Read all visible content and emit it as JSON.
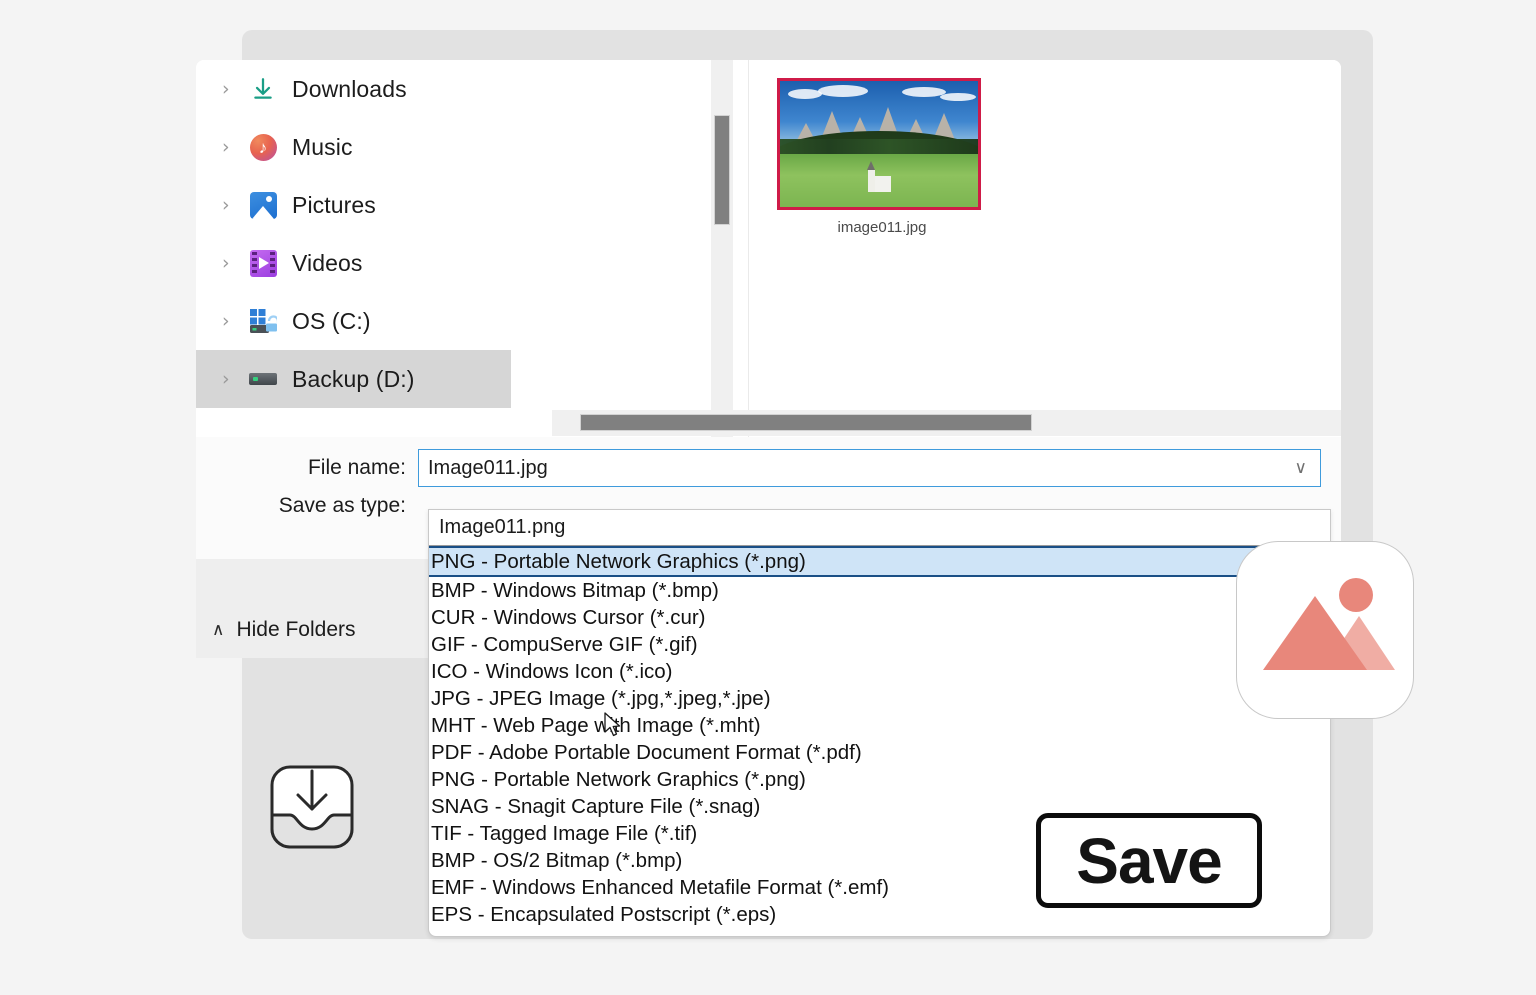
{
  "dialog": {
    "sidebar": {
      "items": [
        {
          "label": "Downloads",
          "icon": "download-arrow-icon",
          "selected": false
        },
        {
          "label": "Music",
          "icon": "music-note-icon",
          "selected": false
        },
        {
          "label": "Pictures",
          "icon": "pictures-icon",
          "selected": false
        },
        {
          "label": "Videos",
          "icon": "videos-film-icon",
          "selected": false
        },
        {
          "label": "OS (C:)",
          "icon": "windows-drive-icon",
          "selected": false
        },
        {
          "label": "Backup (D:)",
          "icon": "hard-drive-icon",
          "selected": true
        }
      ],
      "expand_chevron": "›"
    },
    "file_list": {
      "items": [
        {
          "caption": "image011.jpg",
          "selected": true
        }
      ]
    },
    "form": {
      "file_name_label": "File name:",
      "file_name_value": "Image011.jpg",
      "save_as_type_label": "Save as type:",
      "chevron_down": "∨"
    },
    "bottom": {
      "hide_folders_label": "Hide Folders",
      "hide_folders_caret": "∧"
    }
  },
  "dropdown": {
    "edit_value": "Image011.png",
    "options": [
      {
        "label": "PNG - Portable Network Graphics (*.png)",
        "selected": true
      },
      {
        "label": "BMP - Windows Bitmap (*.bmp)",
        "selected": false
      },
      {
        "label": "CUR - Windows Cursor (*.cur)",
        "selected": false
      },
      {
        "label": "GIF - CompuServe GIF (*.gif)",
        "selected": false
      },
      {
        "label": "ICO - Windows Icon (*.ico)",
        "selected": false
      },
      {
        "label": "JPG - JPEG Image (*.jpg,*.jpeg,*.jpe)",
        "selected": false
      },
      {
        "label": "MHT - Web Page with Image (*.mht)",
        "selected": false
      },
      {
        "label": "PDF - Adobe Portable Document Format (*.pdf)",
        "selected": false
      },
      {
        "label": "PNG - Portable Network Graphics (*.png)",
        "selected": false
      },
      {
        "label": "SNAG - Snagit Capture File (*.snag)",
        "selected": false
      },
      {
        "label": "TIF - Tagged Image File (*.tif)",
        "selected": false
      },
      {
        "label": "BMP - OS/2 Bitmap (*.bmp)",
        "selected": false
      },
      {
        "label": "EMF - Windows Enhanced Metafile Format (*.emf)",
        "selected": false
      },
      {
        "label": "EPS - Encapsulated Postscript (*.eps)",
        "selected": false
      }
    ]
  },
  "overlays": {
    "save_button_label": "Save",
    "image_card_icon": "image-placeholder-icon",
    "download_glyph_icon": "save-download-icon"
  },
  "colors": {
    "page_background": "#f4f4f4",
    "dialog_frame": "#e2e2e2",
    "selection_blue": "#cfe4f7",
    "selection_border": "#1a4f86",
    "input_focus_border": "#3f9bdc",
    "sidebar_selected": "#d6d6d6",
    "thumbnail_border": "#cf1b48",
    "scrollbar_thumb": "#808080",
    "icon_salmon": "#e8877b",
    "icon_salmon_light": "#f0ada4"
  }
}
